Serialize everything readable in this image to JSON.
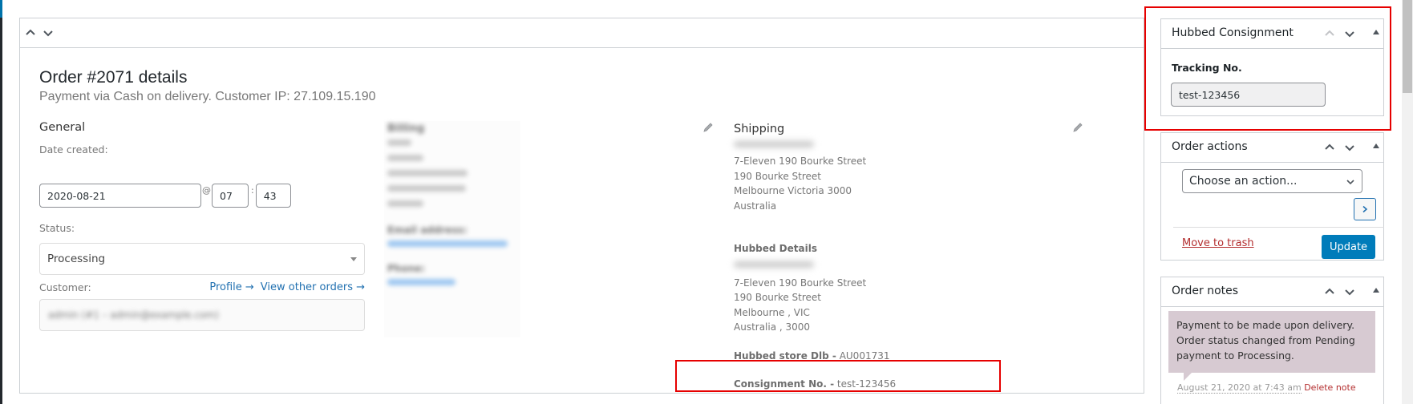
{
  "order": {
    "title": "Order #2071 details",
    "subtitle": "Payment via Cash on delivery. Customer IP: 27.109.15.190"
  },
  "general": {
    "heading": "General",
    "date_label": "Date created:",
    "date_value": "2020-08-21",
    "at_symbol": "@",
    "hour_value": "07",
    "time_sep": ":",
    "minute_value": "43",
    "status_label": "Status:",
    "status_value": "Processing",
    "customer_label": "Customer:",
    "profile_link": "Profile →",
    "other_orders_link": "View other orders →",
    "customer_value": "admin (#1 – admin@example.com)"
  },
  "billing": {
    "heading": "Billing",
    "email_label": "Email address:",
    "phone_label": "Phone:"
  },
  "shipping": {
    "heading": "Shipping",
    "name": "Full Name",
    "address_lines": [
      "7-Eleven 190 Bourke Street",
      "190 Bourke Street",
      "Melbourne Victoria 3000",
      "Australia"
    ],
    "hubbed_heading": "Hubbed Details",
    "hubbed_lines": [
      "7-Eleven 190 Bourke Street",
      "190 Bourke Street",
      "Melbourne , VIC",
      "Australia , 3000"
    ],
    "store_label": "Hubbed store Dlb -",
    "store_value": "AU001731",
    "consignment_label": "Consignment No. -",
    "consignment_value": "test-123456"
  },
  "sidebar": {
    "hubbed": {
      "title": "Hubbed Consignment",
      "tracking_label": "Tracking No.",
      "tracking_value": "test-123456"
    },
    "actions": {
      "title": "Order actions",
      "select_value": "Choose an action...",
      "go_icon": "chevron-right",
      "trash_link": "Move to trash",
      "update_button": "Update"
    },
    "notes": {
      "title": "Order notes",
      "note_text": "Payment to be made upon delivery. Order status changed from Pending payment to Processing.",
      "note_date": "August 21, 2020 at 7:43 am",
      "delete_link": "Delete note"
    }
  },
  "colors": {
    "link": "#2271b1",
    "primary_button": "#007cba",
    "highlight_box": "#e60000",
    "trash_link": "#b32d2e",
    "note_bg": "#d7cad2"
  }
}
